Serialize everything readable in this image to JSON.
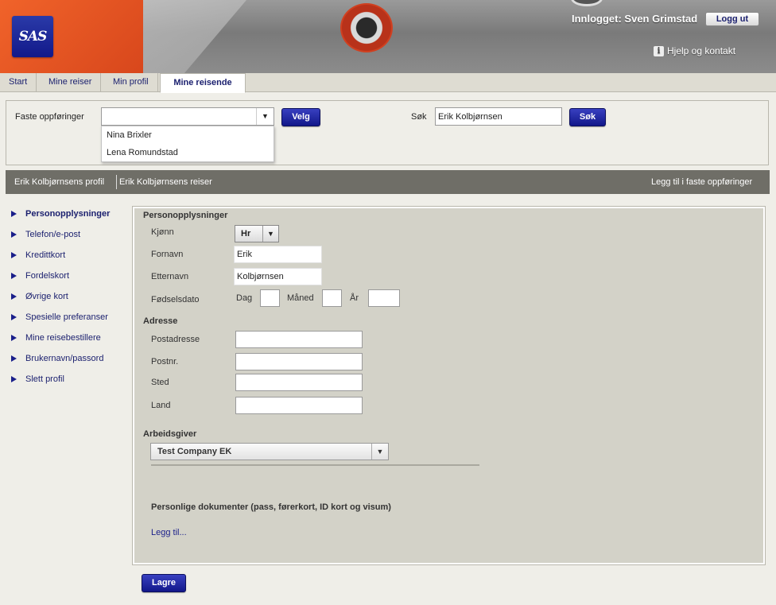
{
  "header": {
    "logo_text": "SAS",
    "logged_in_text": "Innlogget: Sven Grimstad",
    "logout_label": "Logg ut",
    "help_label": "Hjelp og kontakt",
    "accent_color": "#e8561f"
  },
  "tabs": [
    {
      "label": "Start"
    },
    {
      "label": "Mine reiser"
    },
    {
      "label": "Min profil"
    },
    {
      "label": "Mine reisende",
      "active": true
    }
  ],
  "search": {
    "favorites_label": "Faste oppføringer",
    "favorites_value": "",
    "favorites_options": [
      "Nina Brixler",
      "Lena Romundstad"
    ],
    "choose_label": "Velg",
    "search_label": "Søk",
    "search_value": "Erik Kolbjørnsen",
    "search_button": "Søk"
  },
  "profile_bar": {
    "profile_link": "Erik Kolbjørnsens profil",
    "trips_link": "Erik Kolbjørnsens reiser",
    "add_link": "Legg til i faste oppføringer"
  },
  "sidebar": {
    "items": [
      {
        "label": "Personopplysninger",
        "active": true
      },
      {
        "label": "Telefon/e-post"
      },
      {
        "label": "Kredittkort"
      },
      {
        "label": "Fordelskort"
      },
      {
        "label": "Øvrige kort"
      },
      {
        "label": "Spesielle preferanser"
      },
      {
        "label": "Mine reisebestillere"
      },
      {
        "label": "Brukernavn/passord"
      },
      {
        "label": "Slett profil"
      }
    ]
  },
  "form": {
    "personal_heading": "Personopplysninger",
    "gender_label": "Kjønn",
    "gender_value": "Hr",
    "firstname_label": "Fornavn",
    "firstname_value": "Erik",
    "lastname_label": "Etternavn",
    "lastname_value": "Kolbjørnsen",
    "birthdate_label": "Fødselsdato",
    "day_label": "Dag",
    "day_value": "",
    "month_label": "Måned",
    "month_value": "",
    "year_label": "År",
    "year_value": "",
    "address_heading": "Adresse",
    "postal_address_label": "Postadresse",
    "postal_address_value": "",
    "postcode_label": "Postnr.",
    "postcode_value": "",
    "city_label": "Sted",
    "city_value": "",
    "country_label": "Land",
    "country_value": "",
    "employer_heading": "Arbeidsgiver",
    "employer_value": "Test Company EK",
    "documents_heading": "Personlige dokumenter (pass, førerkort, ID kort og visum)",
    "add_document_link": "Legg til...",
    "save_label": "Lagre"
  }
}
